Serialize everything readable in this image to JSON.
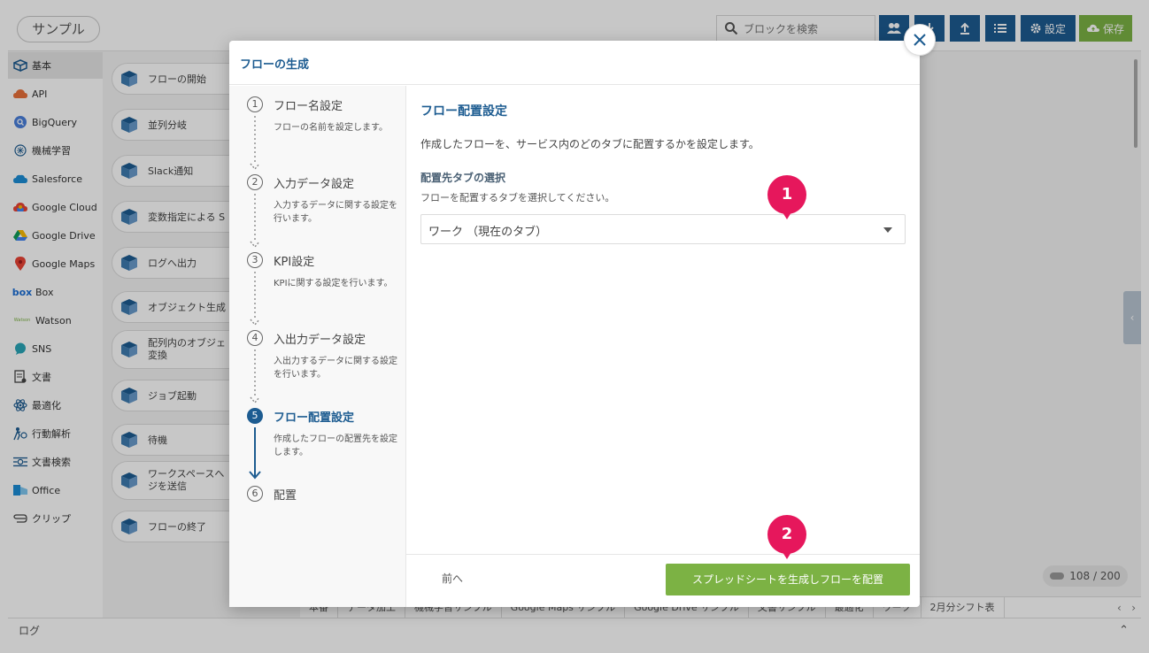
{
  "app": {
    "title": "サンプル",
    "search_placeholder": "ブロックを検索",
    "settings_label": "設定",
    "save_label": "保存"
  },
  "sidebar": {
    "items": [
      {
        "label": "基本",
        "icon": "cube-icon"
      },
      {
        "label": "API",
        "icon": "api-icon"
      },
      {
        "label": "BigQuery",
        "icon": "bigquery-icon"
      },
      {
        "label": "機械学習",
        "icon": "brain-icon"
      },
      {
        "label": "Salesforce",
        "icon": "salesforce-cloud-icon"
      },
      {
        "label": "Google Cloud",
        "icon": "google-cloud-icon"
      },
      {
        "label": "Google Drive",
        "icon": "google-drive-icon"
      },
      {
        "label": "Google Maps",
        "icon": "map-pin-icon"
      },
      {
        "label": "Box",
        "icon": "box-logo-icon"
      },
      {
        "label": "Watson",
        "icon": "watson-logo-icon"
      },
      {
        "label": "SNS",
        "icon": "chat-bubble-icon"
      },
      {
        "label": "文書",
        "icon": "document-icon"
      },
      {
        "label": "最適化",
        "icon": "atom-icon"
      },
      {
        "label": "行動解析",
        "icon": "person-analysis-icon"
      },
      {
        "label": "文書検索",
        "icon": "document-search-icon"
      },
      {
        "label": "Office",
        "icon": "office-icon"
      },
      {
        "label": "クリップ",
        "icon": "paperclip-icon"
      }
    ]
  },
  "palette": {
    "blocks": [
      "フローの開始",
      "並列分岐",
      "Slack通知",
      "変数指定による S",
      "ログへ出力",
      "オブジェクト生成",
      "配列内のオブジェ 変換",
      "ジョブ起動",
      "待機",
      "ワークスペースへ ジを送信",
      "フローの終了"
    ]
  },
  "canvas": {
    "counter": "108 / 200"
  },
  "tabs": [
    "本番",
    "データ加工",
    "機械学習サンプル",
    "Google Maps サンプル",
    "Google Drive サンプル",
    "文書サンプル",
    "最適化",
    "ワーク",
    "2月分シフト表"
  ],
  "logbar": {
    "label": "ログ"
  },
  "modal": {
    "title": "フローの生成",
    "steps": [
      {
        "num": "1",
        "title": "フロー名設定",
        "desc": "フローの名前を設定します。"
      },
      {
        "num": "2",
        "title": "入力データ設定",
        "desc": "入力するデータに関する設定を行います。"
      },
      {
        "num": "3",
        "title": "KPI設定",
        "desc": "KPIに関する設定を行います。"
      },
      {
        "num": "4",
        "title": "入出力データ設定",
        "desc": "入出力するデータに関する設定を行います。"
      },
      {
        "num": "5",
        "title": "フロー配置設定",
        "desc": "作成したフローの配置先を設定します。"
      },
      {
        "num": "6",
        "title": "配置",
        "desc": ""
      }
    ],
    "content": {
      "title": "フロー配置設定",
      "desc": "作成したフローを、サービス内のどのタブに配置するかを設定します。",
      "field_label": "配置先タブの選択",
      "field_help": "フローを配置するタブを選択してください。",
      "select_value": "ワーク （現在のタブ）"
    },
    "footer": {
      "prev_label": "前へ",
      "primary_label": "スプレッドシートを生成しフローを配置"
    }
  },
  "markers": [
    "1",
    "2"
  ],
  "colors": {
    "brand_blue": "#1d5c91",
    "accent_green": "#7cb244",
    "marker_pink": "#e6175c"
  }
}
